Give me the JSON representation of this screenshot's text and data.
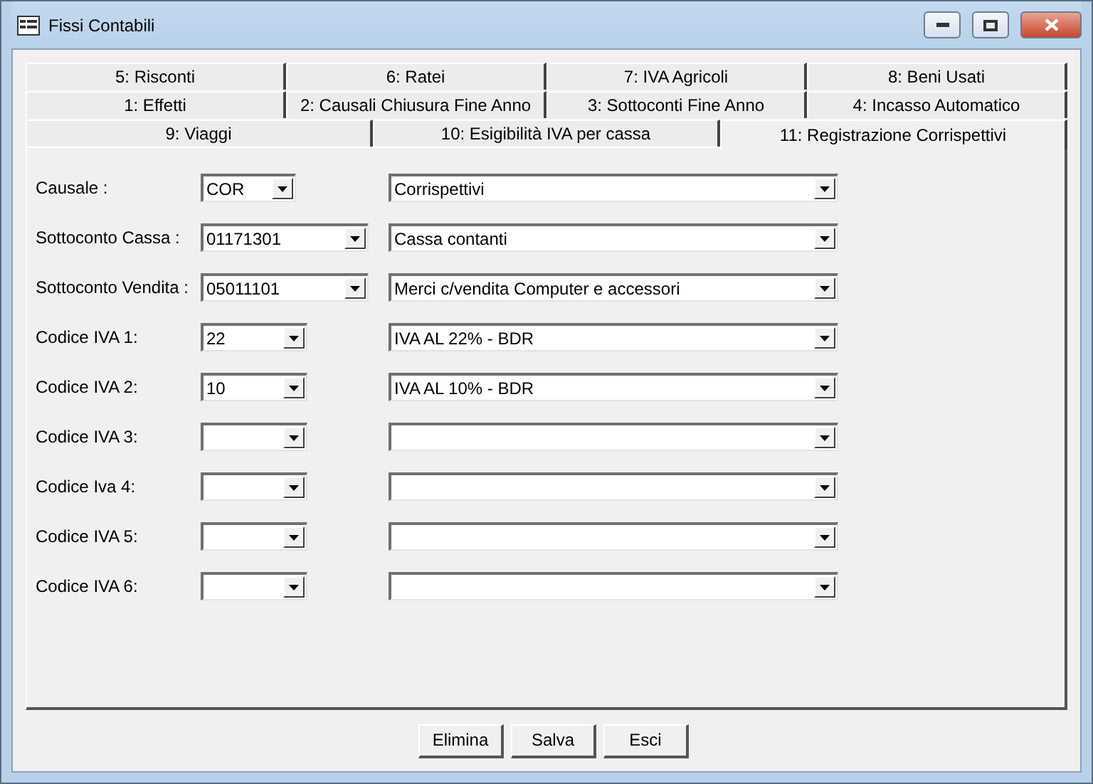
{
  "window": {
    "title": "Fissi Contabili"
  },
  "tab_rows": [
    [
      {
        "label": "5: Risconti",
        "selected": false
      },
      {
        "label": "6: Ratei",
        "selected": false
      },
      {
        "label": "7: IVA Agricoli",
        "selected": false
      },
      {
        "label": "8: Beni Usati",
        "selected": false
      }
    ],
    [
      {
        "label": "1: Effetti",
        "selected": false
      },
      {
        "label": "2: Causali Chiusura Fine Anno",
        "selected": false
      },
      {
        "label": "3: Sottoconti Fine Anno",
        "selected": false
      },
      {
        "label": "4: Incasso Automatico",
        "selected": false
      }
    ],
    [
      {
        "label": "9: Viaggi",
        "selected": false
      },
      {
        "label": "10: Esigibilità IVA per cassa",
        "selected": false
      },
      {
        "label": "11: Registrazione Corrispettivi",
        "selected": true
      }
    ]
  ],
  "fields": [
    {
      "label": "Causale :",
      "kind": "short",
      "code": "COR",
      "description": "Corrispettivi"
    },
    {
      "label": "Sottoconto Cassa :",
      "kind": "long",
      "code": "01171301",
      "description": "Cassa contanti"
    },
    {
      "label": "Sottoconto  Vendita :",
      "kind": "long",
      "code": "05011101",
      "description": "Merci c/vendita Computer e accessori"
    },
    {
      "label": "Codice IVA 1:",
      "kind": "medium",
      "code": "22",
      "description": "IVA AL 22%  -  BDR"
    },
    {
      "label": "Codice IVA 2:",
      "kind": "medium",
      "code": "10",
      "description": "IVA AL 10%  -  BDR"
    },
    {
      "label": "Codice IVA 3:",
      "kind": "medium"
    },
    {
      "label": "Codice Iva 4:",
      "kind": "medium"
    },
    {
      "label": "Codice IVA 5:",
      "kind": "medium"
    },
    {
      "label": "Codice IVA 6:",
      "kind": "medium"
    }
  ],
  "buttons": [
    "Elimina",
    "Salva",
    "Esci"
  ]
}
